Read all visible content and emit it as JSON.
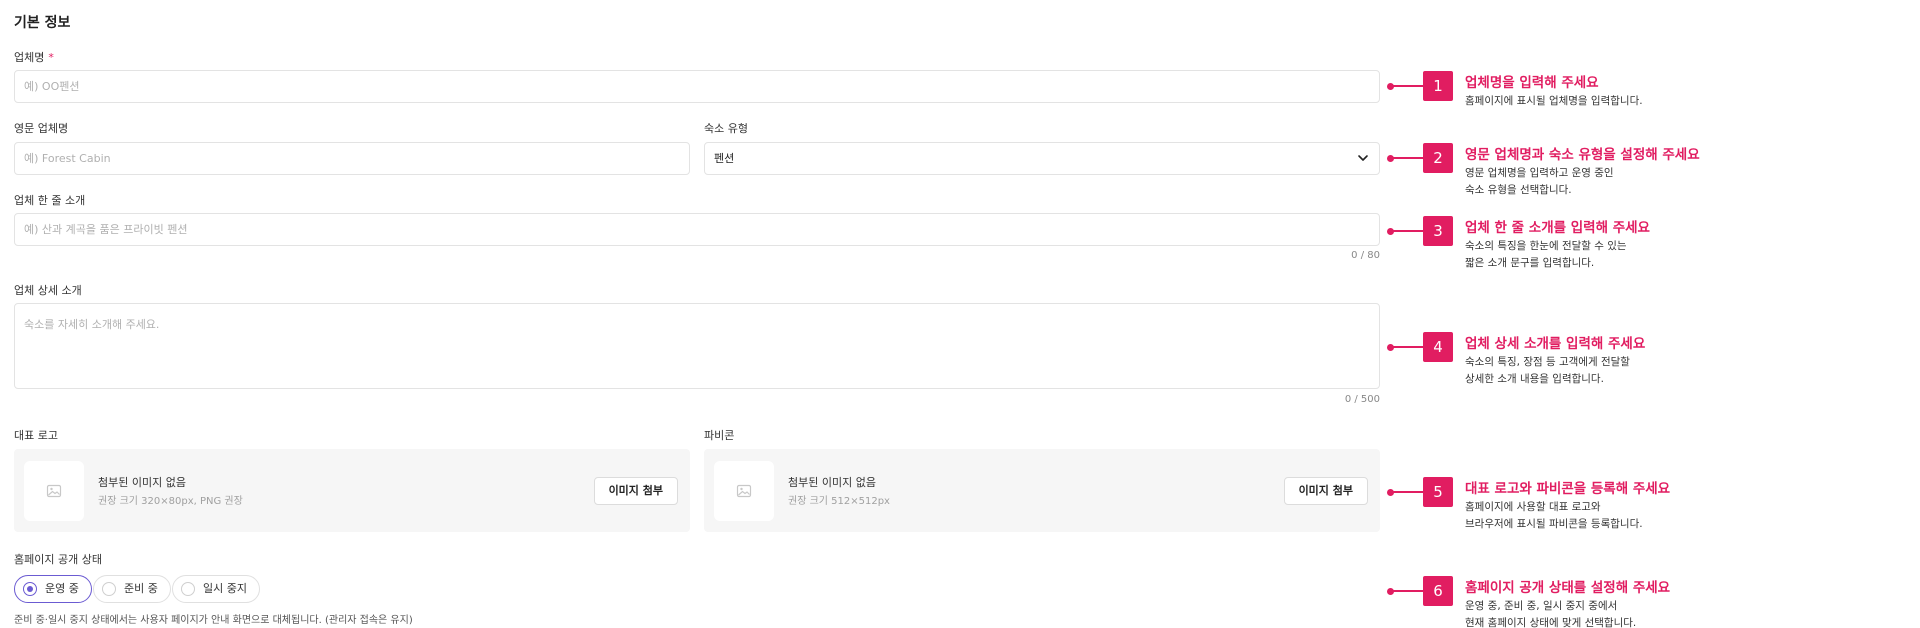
{
  "section_title": "기본 정보",
  "fields": {
    "business_name": {
      "label": "업체명",
      "required_mark": "*",
      "placeholder": "예) OO펜션"
    },
    "english_name": {
      "label": "영문 업체명",
      "placeholder": "예) Forest Cabin"
    },
    "lodging_type": {
      "label": "숙소 유형",
      "value": "펜션"
    },
    "one_line_intro": {
      "label": "업체 한 줄 소개",
      "placeholder": "예) 산과 계곡을 품은 프라이빗 펜션",
      "counter": "0 / 80"
    },
    "detail_intro": {
      "label": "업체 상세 소개",
      "placeholder": "숙소를 자세히 소개해 주세요.",
      "counter": "0 / 500"
    },
    "logo": {
      "label": "대표 로고",
      "empty_text": "첨부된 이미지 없음",
      "hint": "권장 크기 320×80px, PNG 권장",
      "button": "이미지 첨부"
    },
    "favicon": {
      "label": "파비콘",
      "empty_text": "첨부된 이미지 없음",
      "hint": "권장 크기 512×512px",
      "button": "이미지 첨부"
    },
    "status": {
      "label": "홈페이지 공개 상태",
      "options": [
        "운영 중",
        "준비 중",
        "일시 중지"
      ],
      "selected": "운영 중",
      "note": "준비 중·일시 중지 상태에서는 사용자 페이지가 안내 화면으로 대체됩니다. (관리자 접속은 유지)"
    }
  },
  "callouts": [
    {
      "number": "1",
      "title": "업체명을 입력해 주세요",
      "desc": "홈페이지에 표시될 업체명을 입력합니다."
    },
    {
      "number": "2",
      "title": "영문 업체명과 숙소 유형을 설정해 주세요",
      "desc": "영문 업체명을 입력하고 운영 중인\n숙소 유형을 선택합니다."
    },
    {
      "number": "3",
      "title": "업체 한 줄 소개를 입력해 주세요",
      "desc": "숙소의 특징을 한눈에 전달할 수 있는\n짧은 소개 문구를 입력합니다."
    },
    {
      "number": "4",
      "title": "업체 상세 소개를 입력해 주세요",
      "desc": "숙소의 특징, 장점 등 고객에게 전달할\n상세한 소개 내용을 입력합니다."
    },
    {
      "number": "5",
      "title": "대표 로고와 파비콘을 등록해 주세요",
      "desc": "홈페이지에 사용할 대표 로고와\n브라우저에 표시될 파비콘을 등록합니다."
    },
    {
      "number": "6",
      "title": "홈페이지 공개 상태를 설정해 주세요",
      "desc": "운영 중, 준비 중, 일시 중지 중에서\n현재 홈페이지 상태에 맞게 선택합니다."
    }
  ],
  "colors": {
    "accent": "#e11d61",
    "radio_selected": "#6b5bd2"
  },
  "icons": {
    "select": "chevron-down-icon",
    "thumbnail": "image-icon"
  }
}
